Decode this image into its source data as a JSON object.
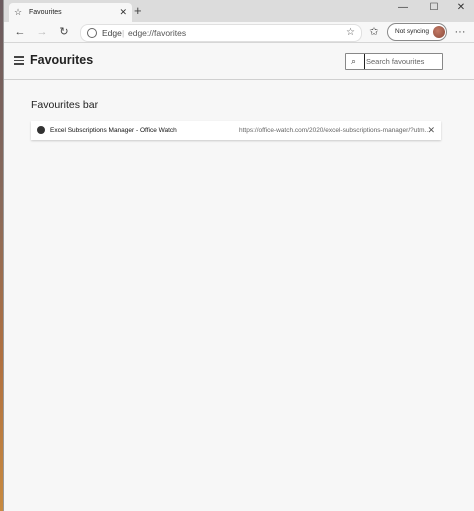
{
  "tab": {
    "title": "Favourites",
    "new_tab": "+"
  },
  "window_controls": {
    "minimize": "—",
    "maximize": "☐",
    "close": "✕"
  },
  "toolbar": {
    "back": "←",
    "forward": "→",
    "refresh": "↻",
    "site_label": "Edge",
    "separator": "|",
    "url": "edge://favorites",
    "favourite_star": "☆",
    "collections": "✩",
    "sync_label": "Not syncing",
    "menu": "···"
  },
  "page": {
    "title": "Favourites",
    "search_placeholder": "Search favourites",
    "section_title": "Favourites bar",
    "items": [
      {
        "name": "Excel Subscriptions Manager - Office Watch",
        "url": "https://office-watch.com/2020/excel-subscriptions-manager/?utm..."
      }
    ]
  }
}
